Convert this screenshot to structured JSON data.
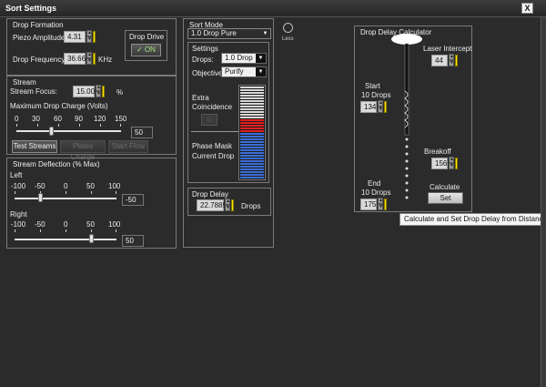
{
  "window": {
    "title": "Sort Settings",
    "close": "X"
  },
  "drop_formation": {
    "title": "Drop Formation",
    "piezo_label": "Piezo Amplitude:",
    "piezo_value": "4.31",
    "freq_label": "Drop Frequency:",
    "freq_value": "36.66",
    "freq_unit": "KHz",
    "drive_title": "Drop Drive",
    "drive_button": "✓ ON"
  },
  "stream": {
    "title": "Stream",
    "focus_label": "Stream Focus:",
    "focus_value": "15.00",
    "focus_unit": "%",
    "charge_label": "Maximum Drop Charge (Volts)",
    "charge_ticks": [
      "0",
      "30",
      "60",
      "90",
      "120",
      "150"
    ],
    "charge_value": "50",
    "charge_fraction": 0.333,
    "buttons": [
      "Test Streams",
      "Plates Charge",
      "Start Flow"
    ]
  },
  "deflection": {
    "title": "Stream Deflection (% Max)",
    "left_label": "Left",
    "left_value": "-50",
    "left_fraction": 0.25,
    "right_label": "Right",
    "right_value": "50",
    "right_fraction": 0.75,
    "ticks": [
      "-100",
      "-50",
      "0",
      "50",
      "100"
    ]
  },
  "sort_mode": {
    "title": "Sort Mode",
    "mode_value": "1.0 Drop Pure",
    "less_label": "Less",
    "settings_title": "Settings",
    "drops_label": "Drops:",
    "drops_value": "1.0 Drop",
    "objective_label": "Objective:",
    "objective_value": "Purify",
    "extra_label": "Extra",
    "coincidence_label": "Coincidence",
    "extra_value": "0",
    "phase_label": "Phase Mask",
    "current_label": "Current Drop",
    "meter_colors": {
      "empty": "#d8d8d8",
      "red": "#e02020",
      "blue": "#3c6fd6"
    }
  },
  "drop_delay": {
    "title": "Drop Delay",
    "value": "22.7889",
    "unit": "Drops"
  },
  "calculator": {
    "title": "Drop Delay Calculator",
    "laser_label": "Laser Intercept",
    "laser_value": "44",
    "start_label": "Start",
    "start_sub": "10 Drops",
    "start_value": "134",
    "breakoff_label": "Breakoff",
    "breakoff_value": "156",
    "end_label": "End",
    "end_sub": "10 Drops",
    "end_value": "175",
    "calculate_label": "Calculate",
    "set_label": "Set"
  },
  "tooltip": "Calculate and Set Drop Delay from Distances"
}
